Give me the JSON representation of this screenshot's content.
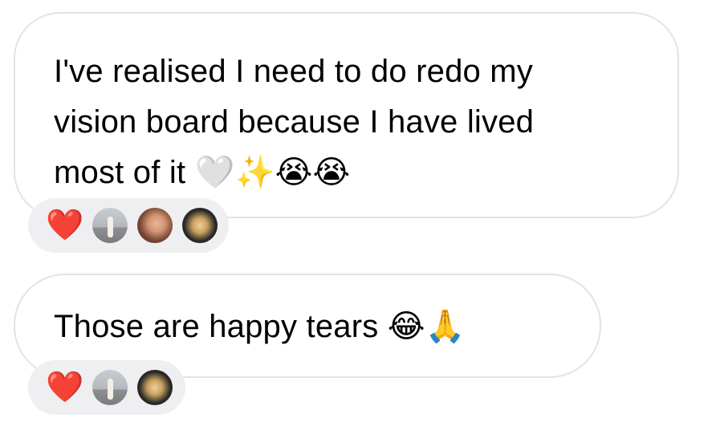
{
  "messages": [
    {
      "text": "I've realised I need to do redo my\nvision board because I have lived\nmost of it 🤍✨😭😭",
      "reactions": {
        "emoji": "❤️",
        "avatars": [
          "avatar-1",
          "avatar-2",
          "avatar-3"
        ]
      }
    },
    {
      "text": "Those are happy tears 😂🙏",
      "reactions": {
        "emoji": "❤️",
        "avatars": [
          "avatar-1",
          "avatar-3"
        ]
      }
    }
  ],
  "colors": {
    "bubble_border": "#e3e3e5",
    "reaction_bg": "#efeff1",
    "heart": "#e0192f",
    "text": "#000000"
  }
}
